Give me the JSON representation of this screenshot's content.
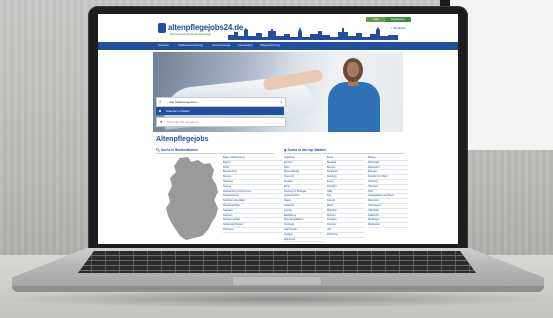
{
  "site": {
    "logo_text": "altenpflegejobs24.de",
    "logo_sub": "Das Karriereportal für die Altenpflege",
    "btn_login": "Login",
    "btn_register": "Registrieren",
    "merkliste": "☆ Merkliste"
  },
  "nav": {
    "items": [
      "Startseite",
      "Stellenausschreibung",
      "Suchwerkzeuge",
      "Karrieretipps",
      "Pflegeeinrichtung"
    ]
  },
  "search": {
    "select_text": "– alle Stellenangebote –",
    "option_active": "Standort ermitteln",
    "location_placeholder": "PLZ oder Ort eingeben"
  },
  "content": {
    "title": "Altenpflegejobs",
    "col1_head": "Suche in Bundesländern",
    "col2_head": "Suche in den top Städten"
  },
  "states": [
    "Baden-Württemberg",
    "Bayern",
    "Berlin",
    "Brandenburg",
    "Bremen",
    "Hamburg",
    "Hessen",
    "Mecklenburg-Vorpommern",
    "Niedersachsen",
    "Nordrhein-Westfalen",
    "Rheinland-Pfalz",
    "Saarland",
    "Sachsen",
    "Sachsen-Anhalt",
    "Schleswig-Holstein",
    "Thüringen"
  ],
  "cities_1": [
    "Augsburg",
    "Bochum",
    "Bonn",
    "Braunschweig",
    "Chemnitz",
    "Dresden",
    "Erfurt",
    "Freiburg im Breisgau",
    "Gelsenkirchen",
    "Hagen",
    "Karlsruhe",
    "Leipzig",
    "Magdeburg",
    "Mönchengladbach",
    "Nürnberg",
    "Saarbrücken",
    "Stuttgart",
    "Wuppertal"
  ],
  "cities_2": [
    "Berlin",
    "Bielefeld",
    "Bremen",
    "Dortmund",
    "Duisburg",
    "Essen",
    "Frankfurt",
    "Halle",
    "Kiel",
    "Lübeck",
    "Mainz",
    "München",
    "Münster",
    "Potsdam",
    "Rostock",
    "Ulm",
    "Würzburg"
  ],
  "cities_3": [
    "Bottrop",
    "Darmstadt",
    "Düsseldorf",
    "Erlangen",
    "Frankfurt am Main",
    "Hamburg",
    "Hannover",
    "Köln",
    "Ludwigshafen am Rhein",
    "Mannheim",
    "Oberhausen",
    "Offenbach",
    "Paderborn",
    "Reutlingen",
    "Wiesbaden"
  ],
  "colors": {
    "brand_blue": "#1f4f9d",
    "nav_blue": "#1f4f9d",
    "green": "#3c8f3c"
  }
}
